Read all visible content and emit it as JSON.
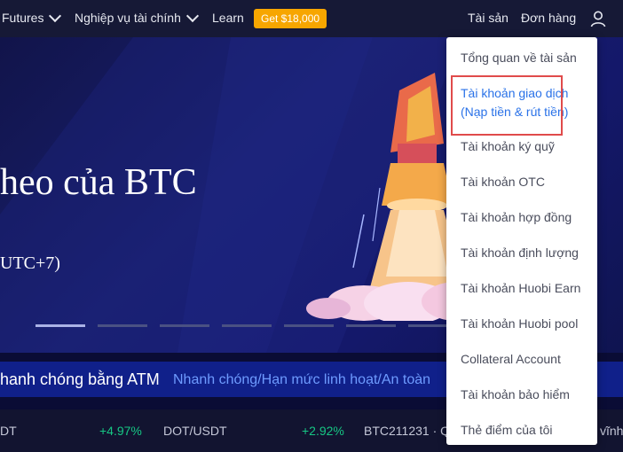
{
  "nav": {
    "futures": "Futures",
    "finance": "Nghiệp vụ tài chính",
    "learn": "Learn",
    "promo": "Get $18,000",
    "assets": "Tài sản",
    "orders": "Đơn hàng",
    "user_icon": "user-icon"
  },
  "hero": {
    "title": "heo của BTC",
    "subtitle": "UTC+7)"
  },
  "banner": {
    "title": "hanh chóng bằng ATM",
    "subtitle": "Nhanh chóng/Hạn mức linh hoạt/An toàn"
  },
  "ticker": [
    {
      "pair": "DT",
      "change": "+4.97%"
    },
    {
      "pair": "DOT/USDT",
      "change": "+2.92%"
    },
    {
      "pair": "BTC211231 · Q",
      "change": ""
    },
    {
      "pair": "vĩnh",
      "change": ""
    }
  ],
  "dropdown": {
    "items": [
      "Tổng quan về tài sản",
      "Tài khoản giao dịch",
      "(Nạp tiền & rút tiền)",
      "Tài khoản ký quỹ",
      "Tài khoản OTC",
      "Tài khoản hợp đồng",
      "Tài khoản định lượng",
      "Tài khoản Huobi Earn",
      "Tài khoản Huobi pool",
      "Collateral Account",
      "Tài khoản bảo hiểm",
      "Thẻ điểm của tôi"
    ],
    "highlighted_index": 1
  },
  "colors": {
    "accent_orange": "#f7a600",
    "link_blue": "#2a72e8",
    "gain_green": "#16c784",
    "highlight_red": "#e04b4b"
  }
}
